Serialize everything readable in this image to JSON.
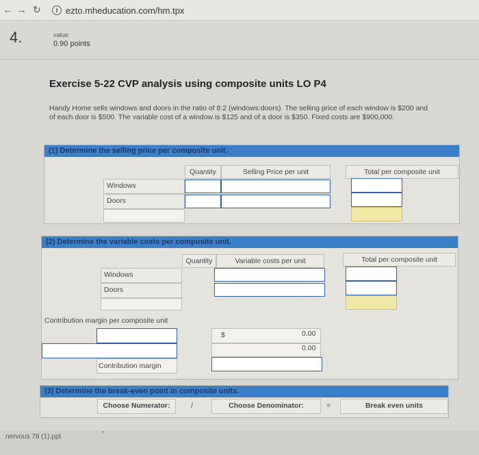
{
  "browser": {
    "url": "ezto.mheducation.com/hm.tpx"
  },
  "question": {
    "number": "4.",
    "value_label": "value:",
    "points": "0.90 points"
  },
  "exercise": {
    "title": "Exercise 5-22 CVP analysis using composite units LO P4",
    "description": "Handy Home sells windows and doors in the ratio of 8:2 (windows:doors). The selling price of each window is $200 and of each door is $500. The variable cost of a window is $125 and of a door is $350. Fixed costs are $900,000."
  },
  "part1": {
    "heading": "(1) Determine the selling price per composite unit.",
    "col_quantity": "Quantity",
    "col_price": "Selling Price per unit",
    "col_total": "Total per composite unit",
    "rows": [
      "Windows",
      "Doors"
    ]
  },
  "part2": {
    "heading": "(2) Determine the variable costs per composite unit.",
    "col_quantity": "Quantity",
    "col_cost": "Variable costs per unit",
    "col_total": "Total per composite unit",
    "rows": [
      "Windows",
      "Doors"
    ],
    "cm_label": "Contribution margin per composite unit",
    "dollar": "$",
    "value1": "0.00",
    "value2": "0.00",
    "cm_row": "Contribution margin"
  },
  "part3": {
    "heading": "(3) Determine the break-even point in composite units.",
    "numerator": "Choose Numerator:",
    "slash": "/",
    "denominator": "Choose Denominator:",
    "equals": "=",
    "result": "Break even units"
  },
  "footer": {
    "file": "nervous 78 (1).ppt"
  }
}
